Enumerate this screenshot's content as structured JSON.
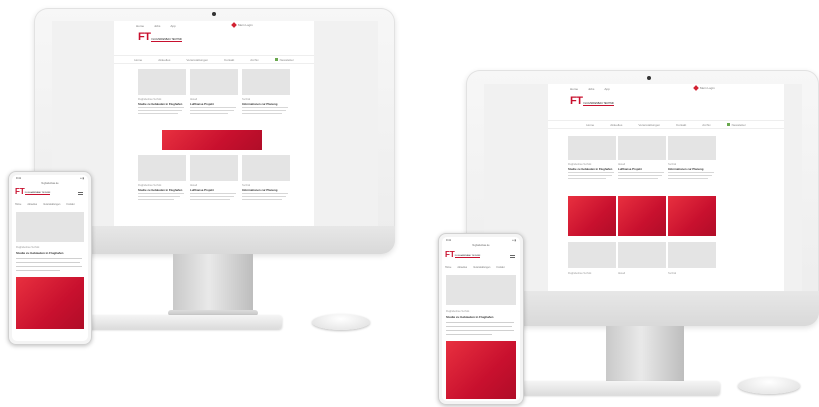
{
  "site": {
    "logo_letters": "FT",
    "logo_tagline": "FLUGHAFENBAU TECHNIK",
    "top_nav": [
      "Home",
      "Jobs",
      "App"
    ],
    "login_label": "Mein Login",
    "main_nav": [
      "Home",
      "Aktuelles",
      "Veranstaltungen",
      "Kontakt",
      "Archiv",
      "Newsletter"
    ],
    "cards": [
      {
        "meta": "Flughafenbau Technik",
        "title": "Studie zu Gebäuden in Flughafen"
      },
      {
        "meta": "Aktuell",
        "title": "Lufthansa Projekt"
      },
      {
        "meta": "Technik",
        "title": "Informationen zur Planung"
      }
    ]
  },
  "phone": {
    "time": "9:41",
    "url": "flughafenbau.de",
    "nav": [
      "Home",
      "Aktuelles",
      "Veranstaltungen",
      "Kontakt"
    ],
    "article_meta": "Flughafenbau Technik",
    "article_title": "Studie zu Gebäuden in Flughafen"
  },
  "colors": {
    "brand_red": "#c8102e",
    "accent_green": "#6aa84f"
  },
  "icons": [
    "camera-icon",
    "heart-icon",
    "menu-icon",
    "signal-icon"
  ]
}
